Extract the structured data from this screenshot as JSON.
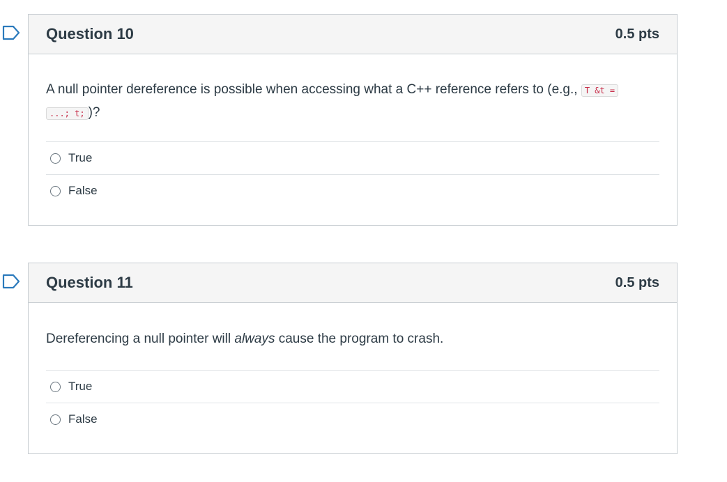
{
  "questions": [
    {
      "title": "Question 10",
      "points": "0.5 pts",
      "text_before": "A null pointer dereference is possible when accessing what a C++ reference refers to (e.g., ",
      "code_part1": "T &t =",
      "code_part2": "...; t;",
      "text_after": ")?",
      "answers": [
        "True",
        "False"
      ]
    },
    {
      "title": "Question 11",
      "points": "0.5 pts",
      "text_before": "Dereferencing a null pointer will ",
      "text_emphasis": "always",
      "text_after": " cause the program to crash.",
      "answers": [
        "True",
        "False"
      ]
    }
  ],
  "colors": {
    "flag": "#2b7abc",
    "header_bg": "#f5f5f5",
    "border": "#c7cdd1",
    "code": "#c72c48"
  }
}
